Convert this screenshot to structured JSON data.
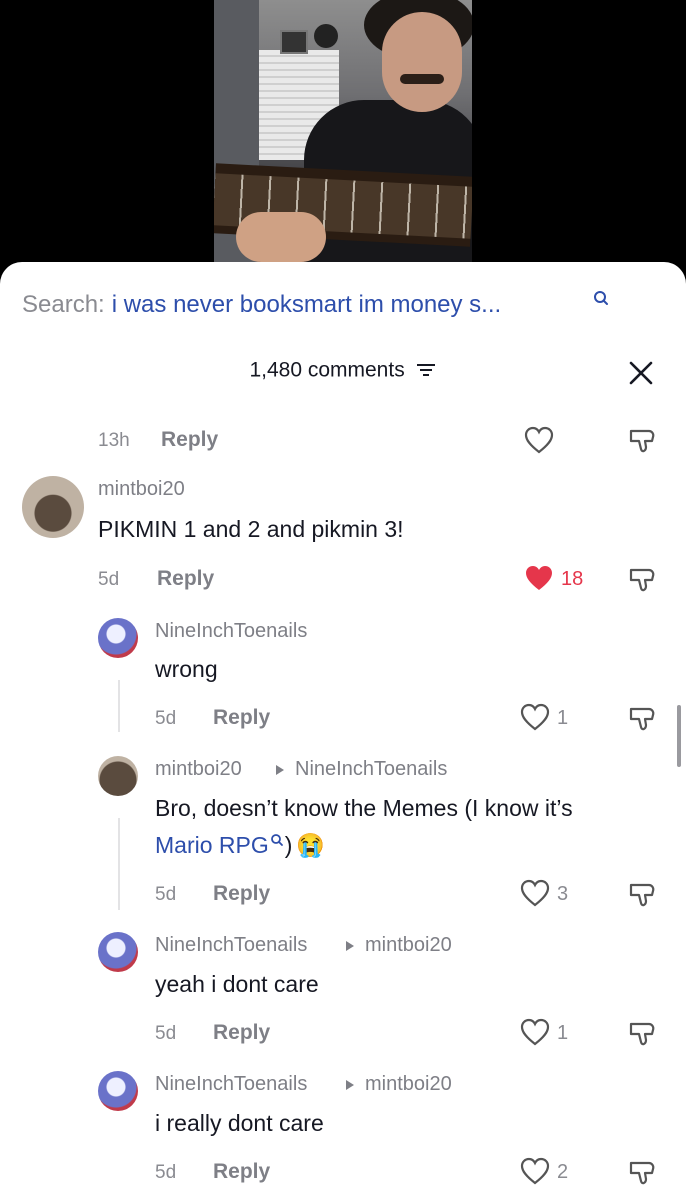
{
  "search": {
    "prefix": "Search:",
    "query": "i was never booksmart im money s..."
  },
  "header": {
    "comments_count": "1,480 comments"
  },
  "comments": [
    {
      "time": "13h",
      "reply": "Reply"
    },
    {
      "username": "mintboi20",
      "text": "PIKMIN 1 and 2 and pikmin 3!",
      "time": "5d",
      "reply": "Reply",
      "likes": "18",
      "liked": true
    },
    {
      "username": "NineInchToenails",
      "text": "wrong",
      "time": "5d",
      "reply": "Reply",
      "likes": "1"
    },
    {
      "username": "mintboi20",
      "reply_to": "NineInchToenails",
      "text_line1": "Bro, doesn’t know the Memes (I know it’s",
      "link": "Mario RPG",
      "text_end": ")",
      "emoji": "😭",
      "time": "5d",
      "reply": "Reply",
      "likes": "3"
    },
    {
      "username": "NineInchToenails",
      "reply_to": "mintboi20",
      "text": "yeah i dont care",
      "time": "5d",
      "reply": "Reply",
      "likes": "1"
    },
    {
      "username": "NineInchToenails",
      "reply_to": "mintboi20",
      "text": "i really dont care",
      "time": "5d",
      "reply": "Reply",
      "likes": "2"
    }
  ],
  "colors": {
    "accent_blue": "#2d4eab",
    "like_red": "#e5364b",
    "muted": "#8a8b91"
  }
}
